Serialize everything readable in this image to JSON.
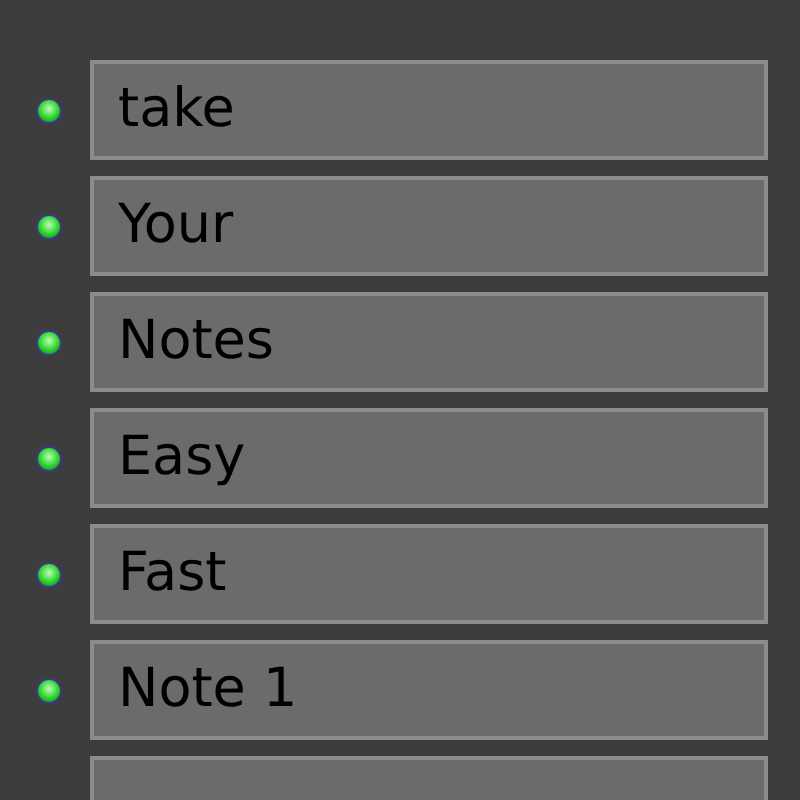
{
  "notes": [
    {
      "kind": "note",
      "text": "take"
    },
    {
      "kind": "note",
      "text": "Your"
    },
    {
      "kind": "note",
      "text": "Notes"
    },
    {
      "kind": "note",
      "text": "Easy"
    },
    {
      "kind": "note",
      "text": "Fast"
    },
    {
      "kind": "note",
      "text": "Note 1"
    },
    {
      "kind": "blank"
    }
  ]
}
